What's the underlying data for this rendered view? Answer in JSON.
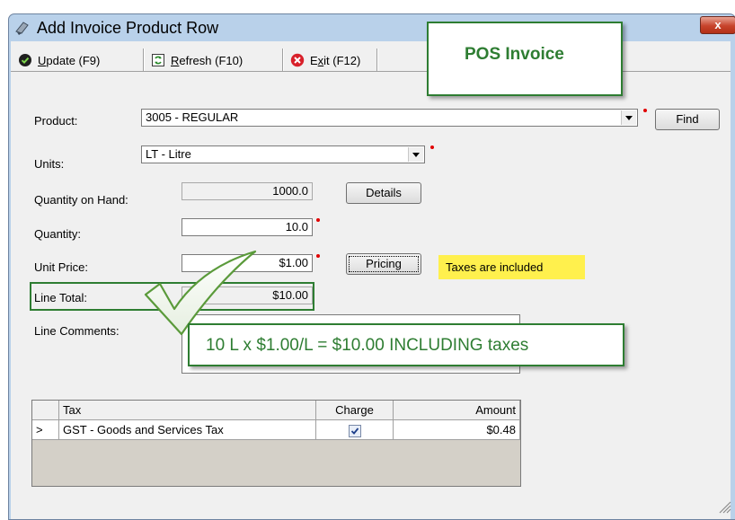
{
  "window": {
    "title": "Add Invoice Product Row",
    "close_label": "x"
  },
  "toolbar": {
    "update": {
      "hotkey": "U",
      "rest": "pdate (F9)"
    },
    "refresh": {
      "hotkey": "R",
      "rest": "efresh (F10)"
    },
    "exit": {
      "prefix": "E",
      "hotkey": "x",
      "rest": "it (F12)"
    }
  },
  "callouts": {
    "pos_invoice": "POS Invoice",
    "including": "10 L x $1.00/L = $10.00 INCLUDING taxes"
  },
  "form": {
    "product_label": "Product:",
    "product_value": "3005 - REGULAR",
    "find_button": "Find",
    "units_label": "Units:",
    "units_value": "LT - Litre",
    "qoh_label": "Quantity on Hand:",
    "qoh_value": "1000.0",
    "details_button": "Details",
    "quantity_label": "Quantity:",
    "quantity_value": "10.0",
    "unit_price_label": "Unit Price:",
    "unit_price_value": "$1.00",
    "pricing_button": "Pricing",
    "taxes_note": "Taxes are included",
    "line_total_label": "Line Total:",
    "line_total_value": "$10.00",
    "line_comments_label": "Line Comments:"
  },
  "tax_grid": {
    "columns": [
      "Tax",
      "Charge",
      "Amount"
    ],
    "rows": [
      {
        "indicator": ">",
        "tax": "GST - Goods and Services Tax",
        "charge": true,
        "amount": "$0.48"
      }
    ]
  },
  "colors": {
    "callout_green": "#2e7d32",
    "note_yellow": "#fff04d",
    "required_red": "#e00000"
  }
}
